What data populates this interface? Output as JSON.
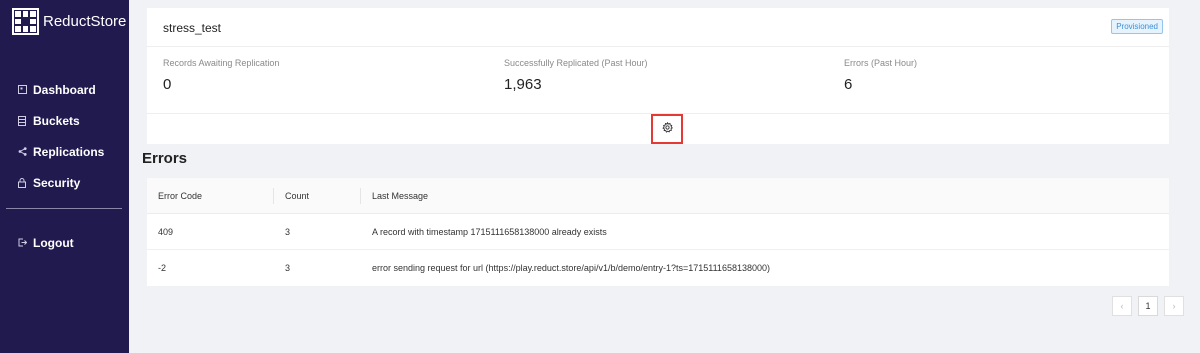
{
  "app": {
    "name": "ReductStore"
  },
  "sidebar": {
    "items": [
      {
        "label": "Dashboard",
        "icon": "dashboard-icon"
      },
      {
        "label": "Buckets",
        "icon": "database-icon"
      },
      {
        "label": "Replications",
        "icon": "share-icon"
      },
      {
        "label": "Security",
        "icon": "lock-icon"
      }
    ],
    "logout_label": "Logout"
  },
  "replication": {
    "name": "stress_test",
    "badge": "Provisioned",
    "stats": [
      {
        "label": "Records Awaiting Replication",
        "value": "0"
      },
      {
        "label": "Successfully Replicated (Past Hour)",
        "value": "1,963"
      },
      {
        "label": "Errors (Past Hour)",
        "value": "6"
      }
    ]
  },
  "errors": {
    "title": "Errors",
    "columns": [
      "Error Code",
      "Count",
      "Last Message"
    ],
    "rows": [
      {
        "code": "409",
        "count": "3",
        "message": "A record with timestamp 1715111658138000 already exists"
      },
      {
        "code": "-2",
        "count": "3",
        "message": "error sending request for url (https://play.reduct.store/api/v1/b/demo/entry-1?ts=1715111658138000)"
      }
    ]
  },
  "pagination": {
    "prev": "‹",
    "current": "1",
    "next": "›"
  },
  "colors": {
    "sidebar": "#211a4f",
    "highlight": "#e53935",
    "badge": "#3d8fd6"
  }
}
